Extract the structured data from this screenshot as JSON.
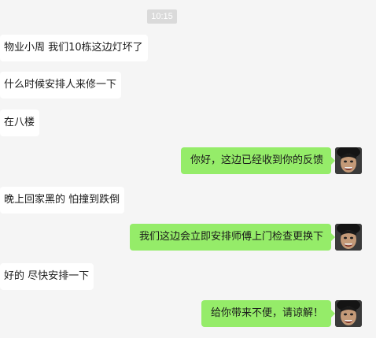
{
  "timestamp": "10:15",
  "messages": [
    {
      "side": "in",
      "text": "物业小周 我们10栋这边灯坏了"
    },
    {
      "side": "in",
      "text": "什么时候安排人来修一下"
    },
    {
      "side": "in",
      "text": "在八楼"
    },
    {
      "side": "out",
      "text": "你好，这边已经收到你的反馈",
      "avatar": "user-avatar"
    },
    {
      "side": "in",
      "text": "晚上回家黑的 怕撞到跌倒"
    },
    {
      "side": "out",
      "text": "我们这边会立即安排师傅上门检查更换下",
      "avatar": "user-avatar"
    },
    {
      "side": "in",
      "text": "好的 尽快安排一下"
    },
    {
      "side": "out",
      "text": "给你带来不便，请谅解！",
      "avatar": "user-avatar"
    }
  ],
  "colors": {
    "background": "#f5f5f5",
    "incoming_bubble": "#ffffff",
    "outgoing_bubble": "#95ec69",
    "timestamp_bg": "#dadada"
  }
}
